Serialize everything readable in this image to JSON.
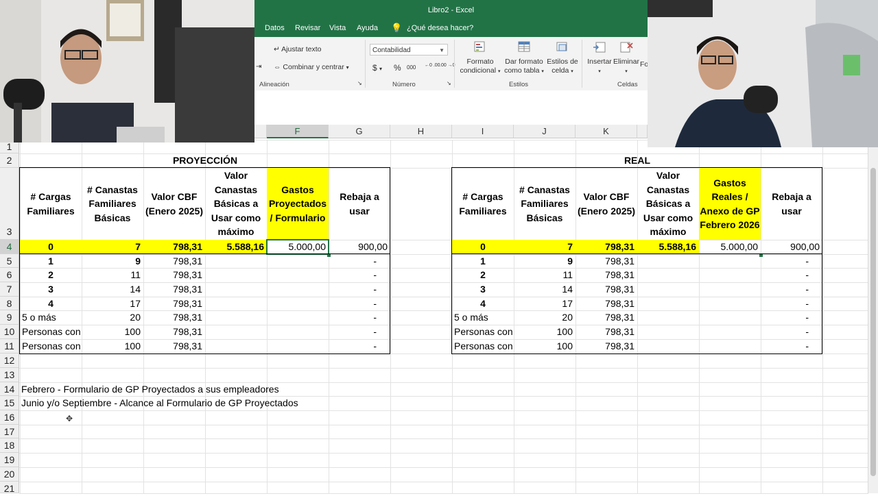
{
  "window": {
    "title": "Libro2  -  Excel"
  },
  "menu": {
    "datos": "Datos",
    "revisar": "Revisar",
    "vista": "Vista",
    "ayuda": "Ayuda",
    "tell_me": "¿Qué desea hacer?"
  },
  "ribbon": {
    "wrap_text": "Ajustar texto",
    "merge_center": "Combinar y centrar",
    "number_format": "Contabilidad",
    "group_alignment": "Alineación",
    "group_number": "Número",
    "group_styles": "Estilos",
    "group_cells": "Celdas",
    "cond_format_1": "Formato",
    "cond_format_2": "condicional",
    "format_table_1": "Dar formato",
    "format_table_2": "como tabla",
    "cell_styles_1": "Estilos de",
    "cell_styles_2": "celda",
    "insert": "Insertar",
    "delete": "Eliminar",
    "format_cut": "Fo",
    "currency": "$",
    "percent": "%",
    "thousands": "000",
    "inc_dec": "←0 .00",
    "dec_dec": ".00 →0"
  },
  "columns": [
    "F",
    "G",
    "H",
    "I",
    "J",
    "K"
  ],
  "rows": [
    "1",
    "2",
    "3",
    "4",
    "5",
    "6",
    "7",
    "8",
    "9",
    "10",
    "11",
    "12",
    "13",
    "14",
    "15",
    "16",
    "17",
    "18",
    "19",
    "20",
    "21"
  ],
  "projection": {
    "title": "PROYECCIÓN",
    "headers": [
      "# Cargas Familiares",
      "# Canastas Familiares Básicas",
      "Valor CBF (Enero 2025)",
      "Valor Canastas Básicas a Usar como máximo",
      "Gastos Proyectados / Formulario",
      "Rebaja a usar"
    ],
    "rows": [
      [
        "0",
        "7",
        "798,31",
        "5.588,16",
        "5.000,00",
        "900,00"
      ],
      [
        "1",
        "9",
        "798,31",
        "",
        "",
        "-"
      ],
      [
        "2",
        "11",
        "798,31",
        "",
        "",
        "-"
      ],
      [
        "3",
        "14",
        "798,31",
        "",
        "",
        "-"
      ],
      [
        "4",
        "17",
        "798,31",
        "",
        "",
        "-"
      ],
      [
        "5 o más",
        "20",
        "798,31",
        "",
        "",
        "-"
      ],
      [
        "Personas con",
        "100",
        "798,31",
        "",
        "",
        "-"
      ],
      [
        "Personas con",
        "100",
        "798,31",
        "",
        "",
        "-"
      ]
    ]
  },
  "real": {
    "title": "REAL",
    "headers": [
      "# Cargas Familiares",
      "# Canastas Familiares Básicas",
      "Valor CBF (Enero 2025)",
      "Valor Canastas Básicas a Usar como máximo",
      "Gastos Reales / Anexo de GP Febrero 2026",
      "Rebaja a usar"
    ],
    "rows": [
      [
        "0",
        "7",
        "798,31",
        "5.588,16",
        "5.000,00",
        "900,00"
      ],
      [
        "1",
        "9",
        "798,31",
        "",
        "",
        "-"
      ],
      [
        "2",
        "11",
        "798,31",
        "",
        "",
        "-"
      ],
      [
        "3",
        "14",
        "798,31",
        "",
        "",
        "-"
      ],
      [
        "4",
        "17",
        "798,31",
        "",
        "",
        "-"
      ],
      [
        "5 o más",
        "20",
        "798,31",
        "",
        "",
        "-"
      ],
      [
        "Personas con",
        "100",
        "798,31",
        "",
        "",
        "-"
      ],
      [
        "Personas con",
        "100",
        "798,31",
        "",
        "",
        "-"
      ]
    ]
  },
  "notes": {
    "row14": "Febrero - Formulario de GP Proyectados a sus empleadores",
    "row15": "Junio y/o Septiembre - Alcance al Formulario de GP Proyectados"
  },
  "colors": {
    "excel_green": "#217346",
    "highlight": "#ffff00"
  }
}
